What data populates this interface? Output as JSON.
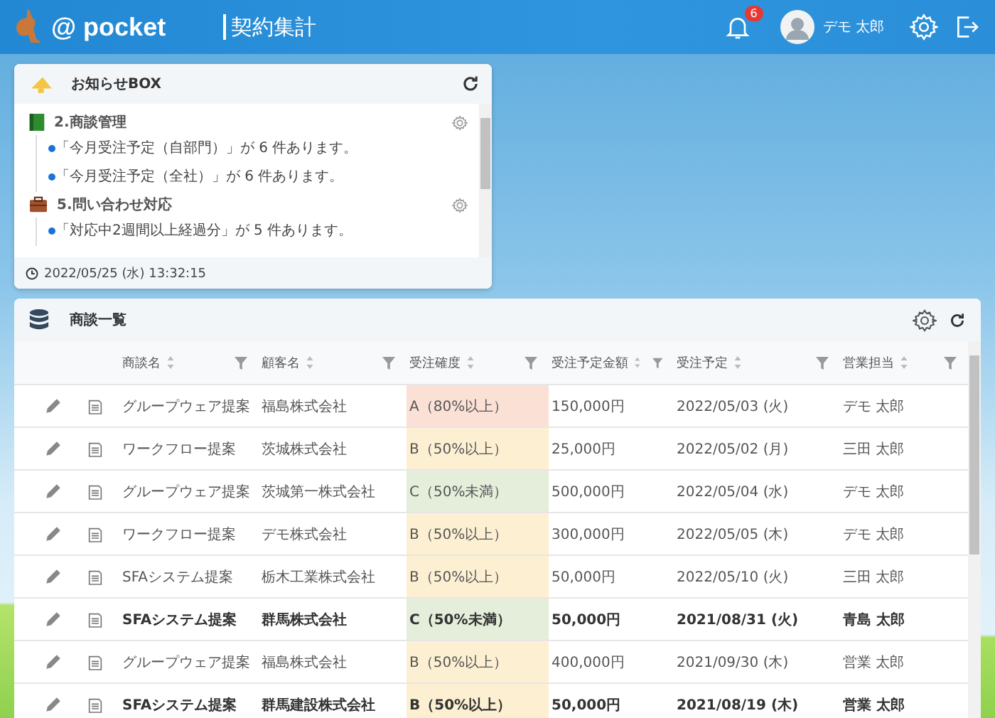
{
  "header": {
    "logo": "@ pocket",
    "title": "契約集計",
    "notification_count": "6",
    "user_name": "デモ 太郎"
  },
  "notice_box": {
    "title": "お知らせBOX",
    "groups": [
      {
        "kind": "book",
        "title": "2.商談管理",
        "items": [
          "「今月受注予定（自部門）」が 6 件あります。",
          "「今月受注予定（全社）」が 6 件あります。"
        ]
      },
      {
        "kind": "briefcase",
        "title": "5.問い合わせ対応",
        "items": [
          "「対応中2週間以上経過分」が 5 件あります。"
        ]
      }
    ],
    "timestamp": "2022/05/25 (水) 13:32:15"
  },
  "deals": {
    "title": "商談一覧",
    "columns": [
      "商談名",
      "顧客名",
      "受注確度",
      "受注予定金額",
      "受注予定",
      "営業担当"
    ],
    "rows": [
      {
        "name": "グループウェア提案",
        "customer": "福島株式会社",
        "probability": "A（80%以上）",
        "color": "#fbe0d6",
        "amount": "150,000円",
        "date": "2022/05/03 (火)",
        "rep": "デモ 太郎",
        "bold": false
      },
      {
        "name": "ワークフロー提案",
        "customer": "茨城株式会社",
        "probability": "B（50%以上）",
        "color": "#fdf0d2",
        "amount": "25,000円",
        "date": "2022/05/02 (月)",
        "rep": "三田 太郎",
        "bold": false
      },
      {
        "name": "グループウェア提案",
        "customer": "茨城第一株式会社",
        "probability": "C（50%未満）",
        "color": "#e4eedb",
        "amount": "500,000円",
        "date": "2022/05/04 (水)",
        "rep": "デモ 太郎",
        "bold": false
      },
      {
        "name": "ワークフロー提案",
        "customer": "デモ株式会社",
        "probability": "B（50%以上）",
        "color": "#fdf0d2",
        "amount": "300,000円",
        "date": "2022/05/05 (木)",
        "rep": "デモ 太郎",
        "bold": false
      },
      {
        "name": "SFAシステム提案",
        "customer": "栃木工業株式会社",
        "probability": "B（50%以上）",
        "color": "#fdf0d2",
        "amount": "50,000円",
        "date": "2022/05/10 (火)",
        "rep": "三田 太郎",
        "bold": false
      },
      {
        "name": "SFAシステム提案",
        "customer": "群馬株式会社",
        "probability": "C（50%未満）",
        "color": "#e4eedb",
        "amount": "50,000円",
        "date": "2021/08/31 (火)",
        "rep": "青島 太郎",
        "bold": true
      },
      {
        "name": "グループウェア提案",
        "customer": "福島株式会社",
        "probability": "B（50%以上）",
        "color": "#fdf0d2",
        "amount": "400,000円",
        "date": "2021/09/30 (木)",
        "rep": "営業 太郎",
        "bold": false
      },
      {
        "name": "SFAシステム提案",
        "customer": "群馬建設株式会社",
        "probability": "B（50%以上）",
        "color": "#fdf0d2",
        "amount": "50,000円",
        "date": "2021/08/19 (木)",
        "rep": "営業 太郎",
        "bold": true
      }
    ]
  }
}
